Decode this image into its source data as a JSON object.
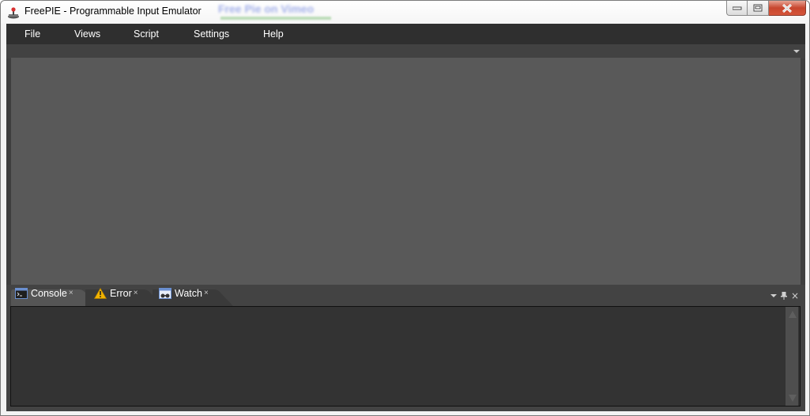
{
  "window": {
    "title": "FreePIE - Programmable Input Emulator",
    "app_icon": "joystick-icon",
    "controls": {
      "minimize": "minimize-icon",
      "maximize": "maximize-icon",
      "close": "close-icon"
    },
    "background_text": "Free Pie on Vimeo"
  },
  "menubar": {
    "items": [
      {
        "label": "File"
      },
      {
        "label": "Views"
      },
      {
        "label": "Script"
      },
      {
        "label": "Settings"
      },
      {
        "label": "Help"
      }
    ]
  },
  "document_well": {
    "dropdown_icon": "chevron-down-icon"
  },
  "tool_pane": {
    "tabs": [
      {
        "label": "Console",
        "icon": "console-icon",
        "close": "×",
        "active": true
      },
      {
        "label": "Error",
        "icon": "warning-icon",
        "close": "×",
        "active": false
      },
      {
        "label": "Watch",
        "icon": "watch-icon",
        "close": "×",
        "active": false
      }
    ],
    "controls": {
      "dropdown": "chevron-down-icon",
      "pin": "pin-icon",
      "close": "×"
    },
    "console_text": ""
  },
  "colors": {
    "menubar_bg": "#2f2f2f",
    "document_area_bg": "#595959",
    "console_bg": "#333333",
    "close_button": "#c7462e",
    "warning_icon": "#f2b300"
  }
}
